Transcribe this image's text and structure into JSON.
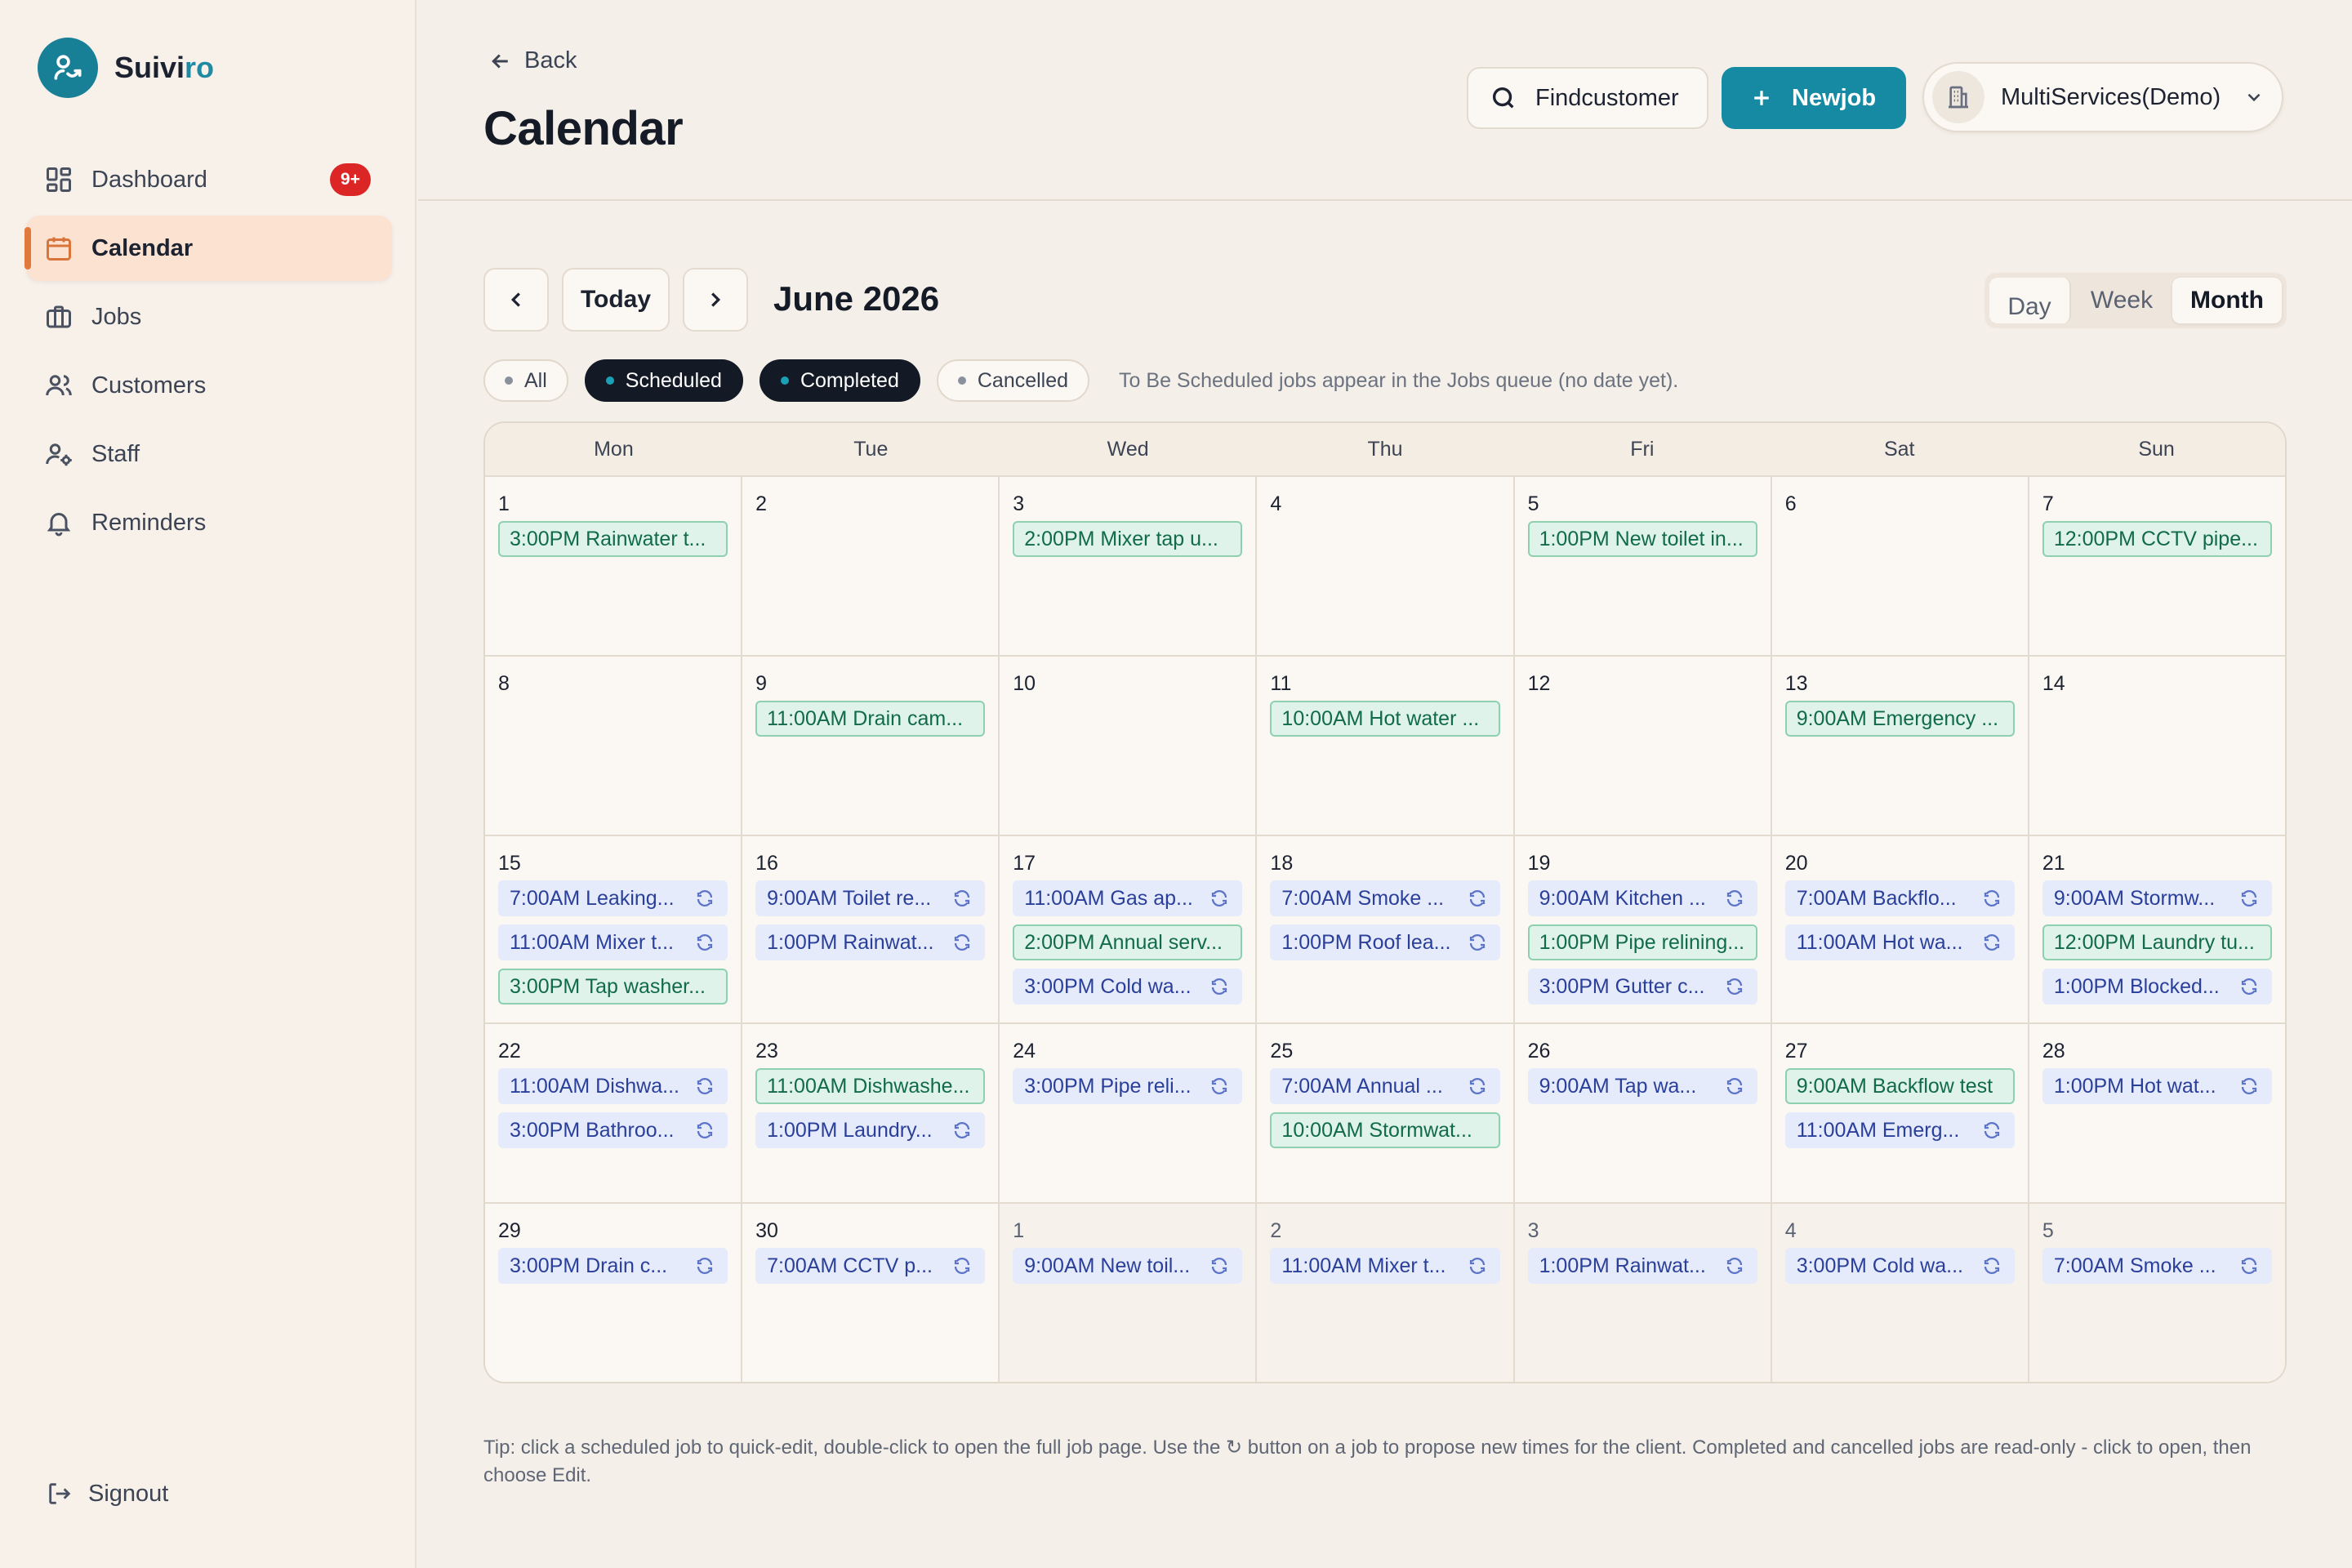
{
  "brand": {
    "name_main": "Suivi",
    "name_accent": "ro"
  },
  "colors": {
    "accent": "#168aa2",
    "active_nav": "#fbe2d1",
    "completed_bg": "#dff3ea",
    "scheduled_bg": "#e5ebfa",
    "badge": "#dc2626"
  },
  "sidebar": {
    "items": [
      {
        "label": "Dashboard",
        "icon": "dashboard-icon",
        "badge": "9+"
      },
      {
        "label": "Calendar",
        "icon": "calendar-icon",
        "active": true
      },
      {
        "label": "Jobs",
        "icon": "briefcase-icon"
      },
      {
        "label": "Customers",
        "icon": "users-icon"
      },
      {
        "label": "Staff",
        "icon": "staff-icon"
      },
      {
        "label": "Reminders",
        "icon": "bell-icon"
      }
    ],
    "signout": "Signout"
  },
  "header": {
    "back": "Back",
    "title": "Calendar",
    "find_customer": "Findcustomer",
    "new_job": "Newjob",
    "org": "MultiServices(Demo)"
  },
  "toolbar": {
    "today": "Today",
    "month_label": "June 2026",
    "views": [
      "Day",
      "Week",
      "Month"
    ],
    "active_view": "Month"
  },
  "filters": {
    "chips": [
      {
        "label": "All",
        "selected": false
      },
      {
        "label": "Scheduled",
        "selected": true
      },
      {
        "label": "Completed",
        "selected": true
      },
      {
        "label": "Cancelled",
        "selected": false
      }
    ],
    "note": "To Be Scheduled jobs appear in the Jobs queue (no date yet)."
  },
  "calendar": {
    "weekdays": [
      "Mon",
      "Tue",
      "Wed",
      "Thu",
      "Fri",
      "Sat",
      "Sun"
    ],
    "weeks": [
      [
        {
          "num": "1",
          "events": [
            {
              "text": "3:00PM Rainwater t...",
              "status": "completed"
            }
          ]
        },
        {
          "num": "2",
          "events": []
        },
        {
          "num": "3",
          "events": [
            {
              "text": "2:00PM Mixer tap u...",
              "status": "completed"
            }
          ]
        },
        {
          "num": "4",
          "events": []
        },
        {
          "num": "5",
          "events": [
            {
              "text": "1:00PM New toilet in...",
              "status": "completed"
            }
          ]
        },
        {
          "num": "6",
          "events": []
        },
        {
          "num": "7",
          "events": [
            {
              "text": "12:00PM CCTV pipe...",
              "status": "completed"
            }
          ]
        }
      ],
      [
        {
          "num": "8",
          "events": []
        },
        {
          "num": "9",
          "events": [
            {
              "text": "11:00AM Drain cam...",
              "status": "completed"
            }
          ]
        },
        {
          "num": "10",
          "events": []
        },
        {
          "num": "11",
          "events": [
            {
              "text": "10:00AM Hot water ...",
              "status": "completed"
            }
          ]
        },
        {
          "num": "12",
          "events": []
        },
        {
          "num": "13",
          "events": [
            {
              "text": "9:00AM Emergency ...",
              "status": "completed"
            }
          ]
        },
        {
          "num": "14",
          "events": []
        }
      ],
      [
        {
          "num": "15",
          "events": [
            {
              "text": "7:00AM Leaking...",
              "status": "scheduled"
            },
            {
              "text": "11:00AM Mixer t...",
              "status": "scheduled"
            },
            {
              "text": "3:00PM Tap washer...",
              "status": "completed"
            }
          ]
        },
        {
          "num": "16",
          "events": [
            {
              "text": "9:00AM Toilet re...",
              "status": "scheduled"
            },
            {
              "text": "1:00PM Rainwat...",
              "status": "scheduled"
            }
          ]
        },
        {
          "num": "17",
          "events": [
            {
              "text": "11:00AM Gas ap...",
              "status": "scheduled"
            },
            {
              "text": "2:00PM Annual serv...",
              "status": "completed"
            },
            {
              "text": "3:00PM Cold wa...",
              "status": "scheduled"
            }
          ]
        },
        {
          "num": "18",
          "events": [
            {
              "text": "7:00AM Smoke ...",
              "status": "scheduled"
            },
            {
              "text": "1:00PM Roof lea...",
              "status": "scheduled"
            }
          ]
        },
        {
          "num": "19",
          "events": [
            {
              "text": "9:00AM Kitchen ...",
              "status": "scheduled"
            },
            {
              "text": "1:00PM Pipe relining...",
              "status": "completed"
            },
            {
              "text": "3:00PM Gutter c...",
              "status": "scheduled"
            }
          ]
        },
        {
          "num": "20",
          "events": [
            {
              "text": "7:00AM Backflo...",
              "status": "scheduled"
            },
            {
              "text": "11:00AM Hot wa...",
              "status": "scheduled"
            }
          ]
        },
        {
          "num": "21",
          "events": [
            {
              "text": "9:00AM Stormw...",
              "status": "scheduled"
            },
            {
              "text": "12:00PM Laundry tu...",
              "status": "completed"
            },
            {
              "text": "1:00PM Blocked...",
              "status": "scheduled"
            }
          ]
        }
      ],
      [
        {
          "num": "22",
          "events": [
            {
              "text": "11:00AM Dishwa...",
              "status": "scheduled"
            },
            {
              "text": "3:00PM Bathroo...",
              "status": "scheduled"
            }
          ]
        },
        {
          "num": "23",
          "events": [
            {
              "text": "11:00AM Dishwashe...",
              "status": "completed"
            },
            {
              "text": "1:00PM Laundry...",
              "status": "scheduled"
            }
          ]
        },
        {
          "num": "24",
          "events": [
            {
              "text": "3:00PM Pipe reli...",
              "status": "scheduled"
            }
          ]
        },
        {
          "num": "25",
          "events": [
            {
              "text": "7:00AM Annual ...",
              "status": "scheduled"
            },
            {
              "text": "10:00AM Stormwat...",
              "status": "completed"
            }
          ]
        },
        {
          "num": "26",
          "events": [
            {
              "text": "9:00AM Tap wa...",
              "status": "scheduled"
            }
          ]
        },
        {
          "num": "27",
          "events": [
            {
              "text": "9:00AM Backflow test",
              "status": "completed"
            },
            {
              "text": "11:00AM Emerg...",
              "status": "scheduled"
            }
          ]
        },
        {
          "num": "28",
          "events": [
            {
              "text": "1:00PM Hot wat...",
              "status": "scheduled"
            }
          ]
        }
      ],
      [
        {
          "num": "29",
          "events": [
            {
              "text": "3:00PM Drain c...",
              "status": "scheduled"
            }
          ]
        },
        {
          "num": "30",
          "events": [
            {
              "text": "7:00AM CCTV p...",
              "status": "scheduled"
            }
          ]
        },
        {
          "num": "1",
          "other": true,
          "events": [
            {
              "text": "9:00AM New toil...",
              "status": "scheduled"
            }
          ]
        },
        {
          "num": "2",
          "other": true,
          "events": [
            {
              "text": "11:00AM Mixer t...",
              "status": "scheduled"
            }
          ]
        },
        {
          "num": "3",
          "other": true,
          "events": [
            {
              "text": "1:00PM Rainwat...",
              "status": "scheduled"
            }
          ]
        },
        {
          "num": "4",
          "other": true,
          "events": [
            {
              "text": "3:00PM Cold wa...",
              "status": "scheduled"
            }
          ]
        },
        {
          "num": "5",
          "other": true,
          "events": [
            {
              "text": "7:00AM Smoke ...",
              "status": "scheduled"
            }
          ]
        }
      ]
    ]
  },
  "tip": "Tip: click a scheduled job to quick-edit, double-click to open the full job page. Use the ↻ button on a job to propose new times for the client. Completed and cancelled jobs are read-only - click to open, then choose Edit."
}
